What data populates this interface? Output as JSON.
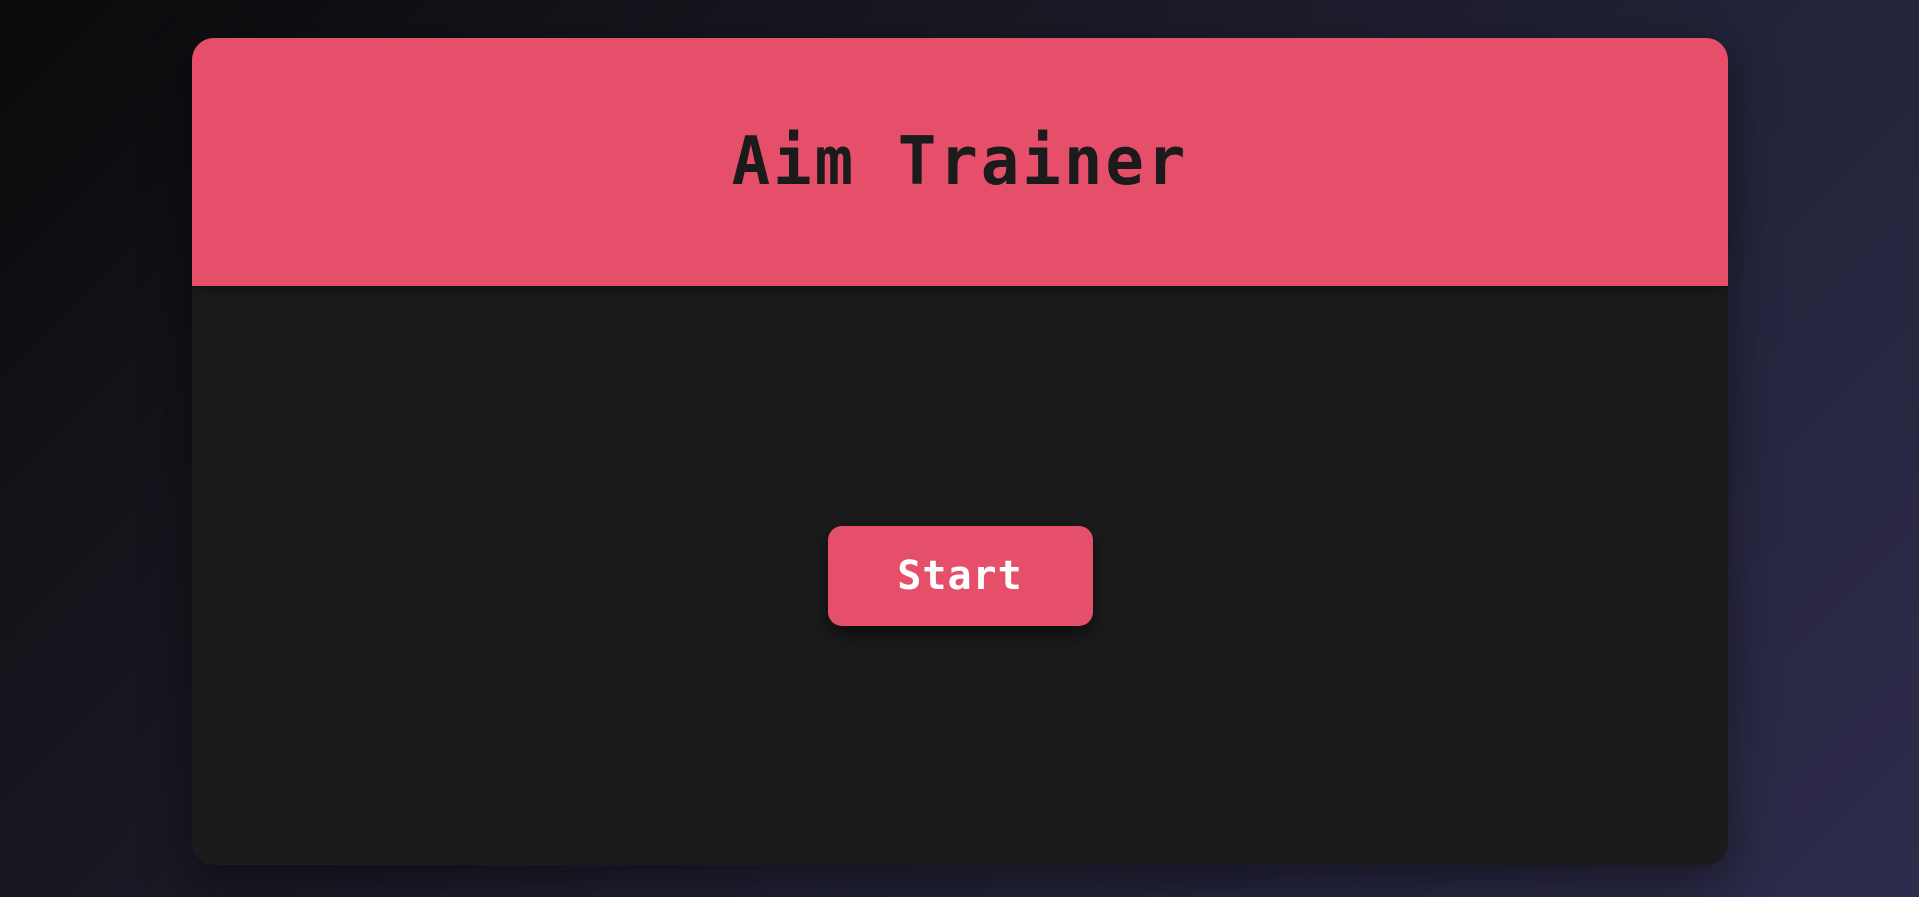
{
  "header": {
    "title": "Aim Trainer"
  },
  "main": {
    "start_label": "Start"
  },
  "colors": {
    "accent": "#e64f69",
    "panel": "#1b1b1b",
    "title_text": "#1b1b1b",
    "button_text": "#ffffff"
  }
}
